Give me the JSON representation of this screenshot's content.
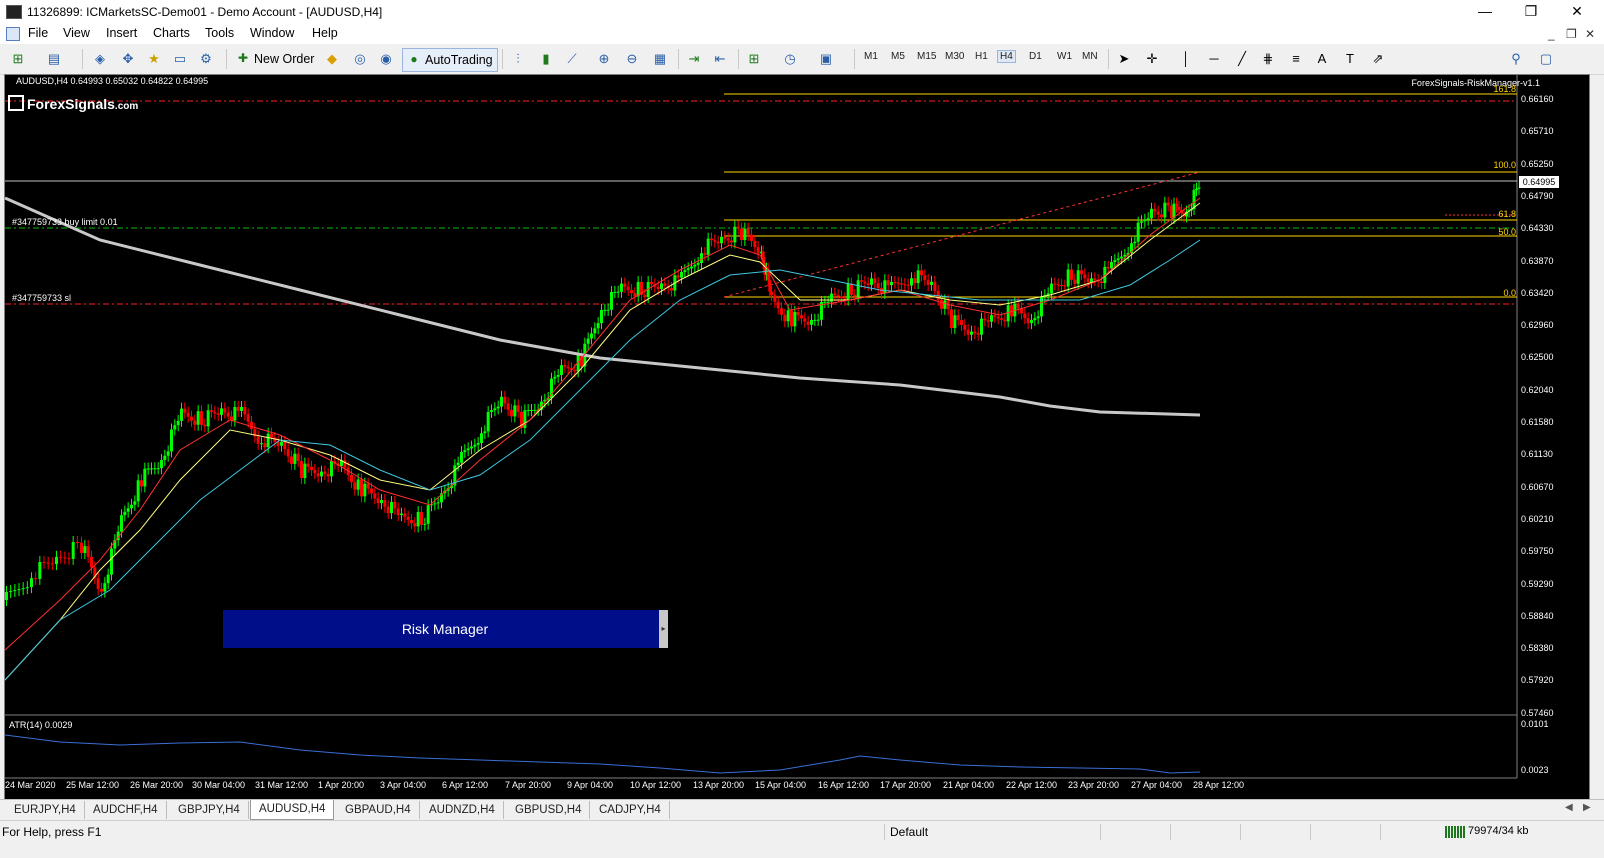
{
  "window": {
    "title": "11326899: ICMarketsSC-Demo01 - Demo Account - [AUDUSD,H4]",
    "controls": {
      "minimize": "—",
      "restore": "❐",
      "close": "✕"
    }
  },
  "menu": {
    "items": [
      "File",
      "View",
      "Insert",
      "Charts",
      "Tools",
      "Window",
      "Help"
    ],
    "mdi_controls": {
      "minimize": "_",
      "restore": "❐",
      "close": "✕"
    }
  },
  "toolbar": {
    "new_order": "New Order",
    "autotrading": "AutoTrading",
    "timeframes": [
      "M1",
      "M5",
      "M15",
      "M30",
      "H1",
      "H4",
      "D1",
      "W1",
      "MN"
    ],
    "active_timeframe": "H4"
  },
  "chart": {
    "info": "AUDUSD,H4  0.64993 0.65032 0.64822 0.64995",
    "logo_main": "ForexSignals",
    "logo_suffix": ".com",
    "indicator_label": "ForexSignals-RiskManager-v1.1",
    "order_line_top": "#347759733",
    "buy_limit_label": "#347759733 buy limit 0.01",
    "sl_label": "#347759733 sl",
    "fib_levels": [
      "161.8",
      "100.0",
      "61.8",
      "50.0",
      "0.0"
    ],
    "price_axis": [
      "0.66160",
      "0.65710",
      "0.65250",
      "0.64790",
      "0.64330",
      "0.63870",
      "0.63420",
      "0.62960",
      "0.62500",
      "0.62040",
      "0.61580",
      "0.61130",
      "0.60670",
      "0.60210",
      "0.59750",
      "0.59290",
      "0.58840",
      "0.58380",
      "0.57920",
      "0.57460"
    ],
    "current_price": "0.64995",
    "date_axis": [
      "24 Mar 2020",
      "25 Mar 12:00",
      "26 Mar 20:00",
      "30 Mar 04:00",
      "31 Mar 12:00",
      "1 Apr 20:00",
      "3 Apr 04:00",
      "6 Apr 12:00",
      "7 Apr 20:00",
      "9 Apr 04:00",
      "10 Apr 12:00",
      "13 Apr 20:00",
      "15 Apr 04:00",
      "16 Apr 12:00",
      "17 Apr 20:00",
      "21 Apr 04:00",
      "22 Apr 12:00",
      "23 Apr 20:00",
      "27 Apr 04:00",
      "28 Apr 12:00"
    ],
    "risk_manager_label": "Risk Manager",
    "atr_label": "ATR(14) 0.0029",
    "atr_axis_top": "0.0101",
    "atr_axis_bottom": "0.0023",
    "colors": {
      "bull": "#00ff00",
      "bear": "#ff0000",
      "ma_slow": "#c8c8c8",
      "ma_fast": "#ff3030",
      "ma_mid": "#ffff80",
      "ma_aqua": "#40c8e0",
      "fib": "#ffd700",
      "atr": "#3b6fd6"
    }
  },
  "tabs": {
    "items": [
      "EURJPY,H4",
      "AUDCHF,H4",
      "GBPJPY,H4",
      "AUDUSD,H4",
      "GBPAUD,H4",
      "AUDNZD,H4",
      "GBPUSD,H4",
      "CADJPY,H4"
    ],
    "active": "AUDUSD,H4"
  },
  "status": {
    "help": "For Help, press F1",
    "profile": "Default",
    "connection": "79974/34 kb"
  }
}
